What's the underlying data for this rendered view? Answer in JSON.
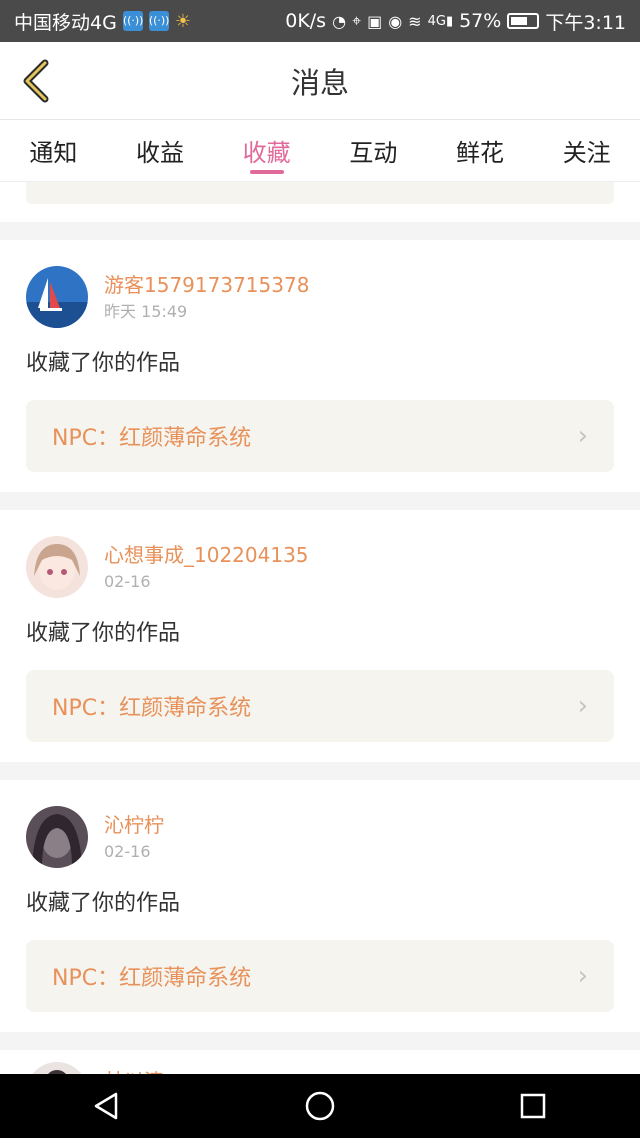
{
  "status_bar": {
    "carrier": "中国移动4G",
    "network_speed": "0K/s",
    "signal_label": "4G",
    "battery": "57%",
    "time": "下午3:11"
  },
  "header": {
    "title": "消息"
  },
  "tabs": [
    {
      "label": "通知",
      "active": false
    },
    {
      "label": "收益",
      "active": false
    },
    {
      "label": "收藏",
      "active": true
    },
    {
      "label": "互动",
      "active": false
    },
    {
      "label": "鲜花",
      "active": false
    },
    {
      "label": "关注",
      "active": false
    }
  ],
  "notifications": [
    {
      "user": "游客1579173715378",
      "time": "昨天 15:49",
      "action": "收藏了你的作品",
      "work": "NPC：红颜薄命系统"
    },
    {
      "user": "心想事成_102204135",
      "time": "02-16",
      "action": "收藏了你的作品",
      "work": "NPC：红颜薄命系统"
    },
    {
      "user": "沁柠柠",
      "time": "02-16",
      "action": "收藏了你的作品",
      "work": "NPC：红颜薄命系统"
    }
  ],
  "partial_item": {
    "user": "林以清"
  },
  "colors": {
    "accent": "#e06b9a",
    "name": "#e8915a",
    "card_bg": "#f5f4ee"
  }
}
